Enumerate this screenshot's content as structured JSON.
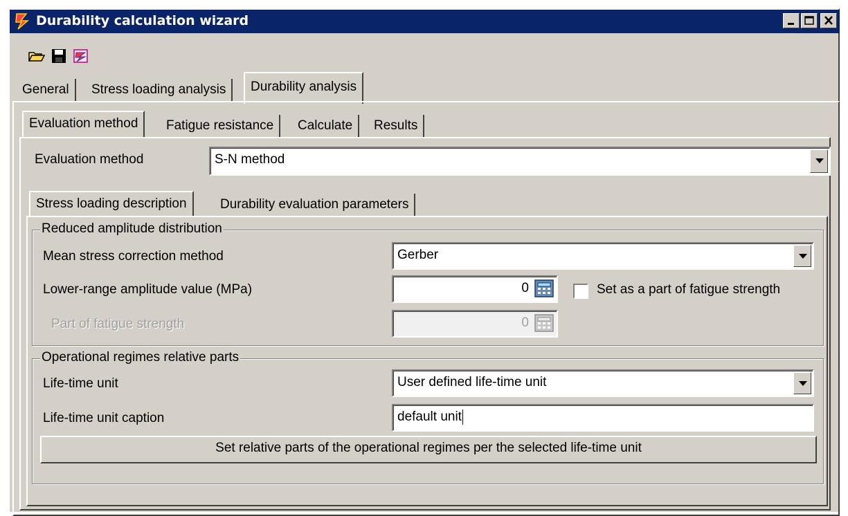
{
  "window": {
    "title": "Durability calculation wizard"
  },
  "toolbar": {
    "icons": [
      "open-folder-icon",
      "save-icon",
      "wizard-icon"
    ]
  },
  "main_tabs": [
    {
      "label": "General",
      "active": false
    },
    {
      "label": "Stress loading analysis",
      "active": false
    },
    {
      "label": "Durability analysis",
      "active": true
    }
  ],
  "sub_tabs": [
    {
      "label": "Evaluation method",
      "active": true
    },
    {
      "label": "Fatigue resistance",
      "active": false
    },
    {
      "label": "Calculate",
      "active": false
    },
    {
      "label": "Results",
      "active": false
    }
  ],
  "evaluation": {
    "label": "Evaluation method",
    "value": "S-N method"
  },
  "inner_tabs": [
    {
      "label": "Stress loading description",
      "active": true
    },
    {
      "label": "Durability evaluation parameters",
      "active": false
    }
  ],
  "reduced_group": {
    "caption": "Reduced amplitude distribution",
    "mean_stress_label": "Mean stress correction method",
    "mean_stress_value": "Gerber",
    "lower_range_label": "Lower-range amplitude value (MPa)",
    "lower_range_value": "0",
    "set_part_label": "Set as a part of fatigue strength",
    "set_part_checked": false,
    "part_label": "Part of fatigue strength",
    "part_value": "0"
  },
  "regimes_group": {
    "caption": "Operational regimes relative parts",
    "lifetime_unit_label": "Life-time unit",
    "lifetime_unit_value": "User defined life-time unit",
    "caption_label": "Life-time unit caption",
    "caption_value": "default unit",
    "set_parts_button": "Set relative parts of the operational regimes per the selected life-time unit"
  },
  "colors": {
    "titlebar": "#0a246a",
    "face": "#d4d0c8"
  }
}
